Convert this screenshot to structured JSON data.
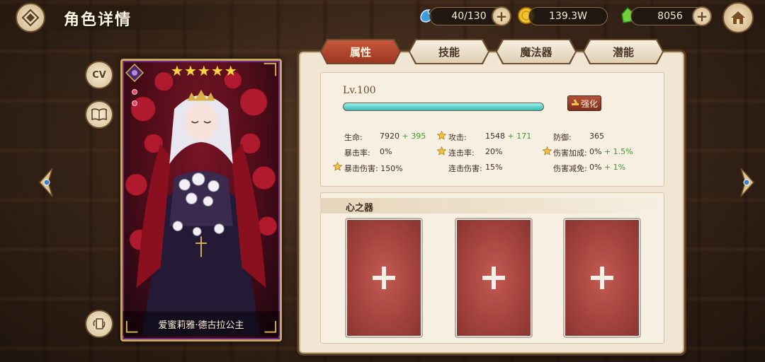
{
  "header": {
    "title": "角色详情",
    "stamina": "40/130",
    "gold": "139.3W",
    "gems": "8056"
  },
  "left": {
    "cv_label": "CV"
  },
  "card": {
    "name": "爱蜜莉雅·德古拉公主",
    "stars": 5
  },
  "tabs": [
    {
      "label": "属性",
      "active": true
    },
    {
      "label": "技能",
      "active": false
    },
    {
      "label": "魔法器",
      "active": false
    },
    {
      "label": "潜能",
      "active": false
    }
  ],
  "attributes": {
    "level": "Lv.100",
    "level_progress": 1.0,
    "enhance_label": "强化",
    "stats": [
      {
        "label": "生命:",
        "value": "7920",
        "bonus": "+ 395",
        "starred": false
      },
      {
        "label": "攻击:",
        "value": "1548",
        "bonus": "+ 171",
        "starred": true
      },
      {
        "label": "防御:",
        "value": "365",
        "bonus": "",
        "starred": false
      },
      {
        "label": "暴击率:",
        "value": "0%",
        "bonus": "",
        "starred": false
      },
      {
        "label": "连击率:",
        "value": "20%",
        "bonus": "",
        "starred": true
      },
      {
        "label": "伤害加成:",
        "value": "0%",
        "bonus": "+ 1.5%",
        "starred": true
      },
      {
        "label": "暴击伤害:",
        "value": "150%",
        "bonus": "",
        "starred": true
      },
      {
        "label": "连击伤害:",
        "value": "15%",
        "bonus": "",
        "starred": false
      },
      {
        "label": "伤害减免:",
        "value": "0%",
        "bonus": "+ 1%",
        "starred": false
      }
    ]
  },
  "heart_section": {
    "title": "心之器"
  },
  "colors": {
    "accent_red": "#9c3622",
    "bonus_green": "#3c9a2c",
    "progress_cyan": "#3ab8b4"
  }
}
